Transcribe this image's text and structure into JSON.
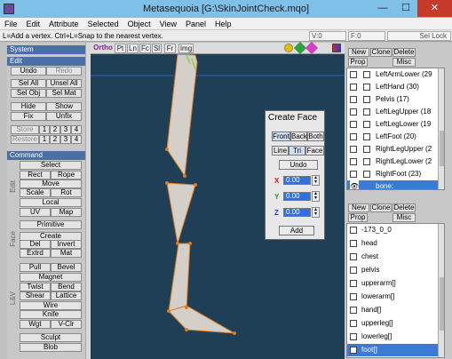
{
  "window": {
    "title": "Metasequoia [G:\\SkinJointCheck.mqo]",
    "minimize": "—",
    "maximize": "☐",
    "close": "✕",
    "close_bg": "#c63a2c"
  },
  "menu": [
    "File",
    "Edit",
    "Attribute",
    "Selected",
    "Object",
    "View",
    "Panel",
    "Help"
  ],
  "status": {
    "hint": "L=Add a vertex.  Ctrl+L=Snap to the nearest vertex.",
    "v": "V:0",
    "f": "F:0",
    "lock": "Sel Lock"
  },
  "left": {
    "system": "System",
    "edit": "Edit",
    "undo": "Undo",
    "redo": "Redo",
    "sel_all": "Sel All",
    "unsel_all": "Unsel All",
    "sel_obj": "Sel Obj",
    "sel_mat": "Sel Mat",
    "hide": "Hide",
    "show": "Show",
    "fix": "Fix",
    "unfix": "Unfix",
    "store": "Store",
    "restore": "Restore",
    "nums": [
      "1",
      "2",
      "3",
      "4"
    ],
    "command": "Command",
    "select": "Select",
    "rect": "Rect",
    "rope": "Rope",
    "move": "Move",
    "scale": "Scale",
    "rot": "Rot",
    "local": "Local",
    "uv": "UV",
    "map": "Map",
    "edit_v": "Edit",
    "primitive": "Primitive",
    "create": "Create",
    "del": "Del",
    "invert": "Invert",
    "extrd": "Extrd",
    "mat": "Mat",
    "face_v": "Face",
    "pull": "Pull",
    "bevel": "Bevel",
    "magnet": "Magnet",
    "twist": "Twist",
    "bend": "Bend",
    "shear": "Shear",
    "lattice": "Lattice",
    "wire": "Wire",
    "knife": "Knife",
    "wgt": "Wgt",
    "vclr": "V-Clr",
    "lv_v": "L&V",
    "sculpt": "Sculpt",
    "blob": "Blob"
  },
  "viewport": {
    "ortho": "Ortho",
    "views": [
      "Pt",
      "Ln",
      "Fc",
      "Sl",
      "Fr",
      "Img"
    ],
    "icons": [
      "zoom-icon",
      "move-view-icon",
      "rotate-view-icon",
      "color-view-icon"
    ]
  },
  "create_face": {
    "title": "Create Face",
    "front": "Front",
    "back": "Back",
    "both": "Both",
    "line": "Line",
    "tri": "Tri",
    "face": "Face",
    "undo": "Undo",
    "x": "X",
    "y": "Y",
    "z": "Z",
    "xv": "0.00",
    "yv": "0.00",
    "zv": "0.00",
    "add": "Add"
  },
  "objects": {
    "new": "New",
    "clone": "Clone",
    "delete": "Delete",
    "prop": "Prop",
    "misc": "Misc",
    "items": [
      "LeftArmLower (29",
      "LeftHand (30)",
      "Pelvis (17)",
      "LeftLegUpper (18",
      "LeftLegLower (19",
      "LeftFoot (20)",
      "RightLegUpper (2",
      "RightLegLower (2",
      "RightFoot (23)",
      "bone:"
    ]
  },
  "materials": {
    "new": "New",
    "clone": "Clone",
    "delete": "Delete",
    "prop": "Prop",
    "misc": "Misc",
    "items": [
      "-173_0_0",
      "head",
      "chest",
      "pelvis",
      "upperarm[]",
      "lowerarm[]",
      "hand[]",
      "upperleg[]",
      "lowerleg[]",
      "foot[]"
    ]
  },
  "colors": {
    "accent": "#3a7bd5",
    "viewport": "#1f3f56",
    "bone": "#d4cfc8",
    "vertex": "#e07a1a"
  }
}
